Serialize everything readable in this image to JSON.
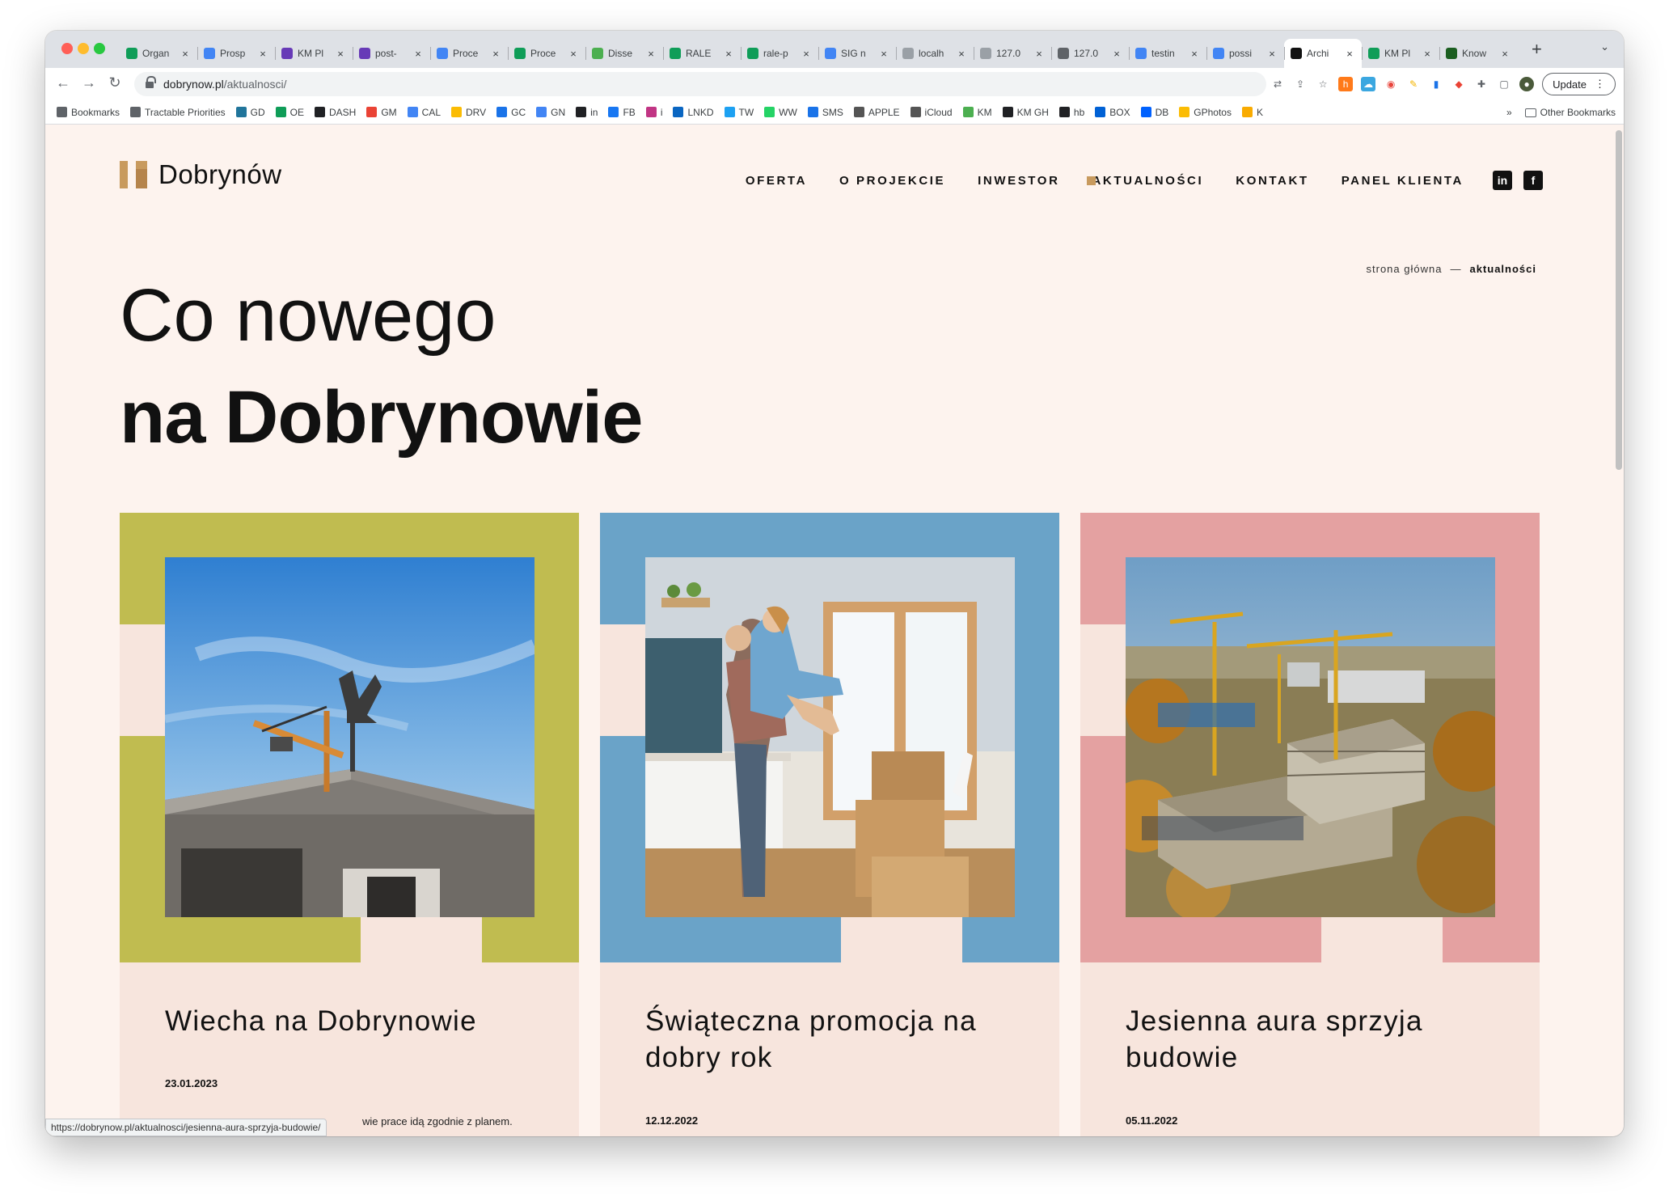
{
  "browser": {
    "tabs": [
      {
        "title": "Organ",
        "icon": "sheets-icon",
        "color": "#0f9d58"
      },
      {
        "title": "Prosp",
        "icon": "drive-icon",
        "color": "#4285f4"
      },
      {
        "title": "KM Pl",
        "icon": "forms-icon",
        "color": "#673ab7"
      },
      {
        "title": "post-",
        "icon": "forms-icon",
        "color": "#673ab7"
      },
      {
        "title": "Proce",
        "icon": "docs-icon",
        "color": "#4285f4"
      },
      {
        "title": "Proce",
        "icon": "sheets-icon",
        "color": "#0f9d58"
      },
      {
        "title": "Disse",
        "icon": "leaf-icon",
        "color": "#4caf50"
      },
      {
        "title": "RALE",
        "icon": "sheets-icon",
        "color": "#0f9d58"
      },
      {
        "title": "rale-p",
        "icon": "sheets-icon",
        "color": "#0f9d58"
      },
      {
        "title": "SIG n",
        "icon": "docs-icon",
        "color": "#4285f4"
      },
      {
        "title": "localh",
        "icon": "page-icon",
        "color": "#9aa0a6"
      },
      {
        "title": "127.0",
        "icon": "page-icon",
        "color": "#9aa0a6"
      },
      {
        "title": "127.0",
        "icon": "globe-icon",
        "color": "#5f6368"
      },
      {
        "title": "testin",
        "icon": "docs-icon",
        "color": "#4285f4"
      },
      {
        "title": "possi",
        "icon": "docs-icon",
        "color": "#4285f4"
      },
      {
        "title": "Archi",
        "icon": "dobrynow-icon",
        "color": "#111111",
        "active": true
      },
      {
        "title": "KM Pl",
        "icon": "sheets-icon",
        "color": "#0f9d58"
      },
      {
        "title": "Know",
        "icon": "kb-icon",
        "color": "#1b5e20"
      }
    ],
    "url_host": "dobrynow.pl",
    "url_path": "/aktualnosci/",
    "update_label": "Update",
    "bookmarks": [
      {
        "label": "Bookmarks",
        "icon": "star-icon",
        "color": "#5f6368"
      },
      {
        "label": "Tractable Priorities",
        "icon": "folder-icon",
        "color": "#5f6368"
      },
      {
        "label": "GD",
        "icon": "wordpress-icon",
        "color": "#21759b"
      },
      {
        "label": "OE",
        "icon": "sheets-icon",
        "color": "#0f9d58"
      },
      {
        "label": "DASH",
        "icon": "bars-icon",
        "color": "#202124"
      },
      {
        "label": "GM",
        "icon": "gmail-icon",
        "color": "#ea4335"
      },
      {
        "label": "CAL",
        "icon": "calendar-icon",
        "color": "#4285f4"
      },
      {
        "label": "DRV",
        "icon": "drive-icon",
        "color": "#fbbc04"
      },
      {
        "label": "GC",
        "icon": "contacts-icon",
        "color": "#1a73e8"
      },
      {
        "label": "GN",
        "icon": "news-icon",
        "color": "#4285f4"
      },
      {
        "label": "in",
        "icon": "text-icon",
        "color": "#202124"
      },
      {
        "label": "FB",
        "icon": "facebook-icon",
        "color": "#1877f2"
      },
      {
        "label": "i",
        "icon": "instagram-icon",
        "color": "#c13584"
      },
      {
        "label": "LNKD",
        "icon": "linkedin-icon",
        "color": "#0a66c2"
      },
      {
        "label": "TW",
        "icon": "twitter-icon",
        "color": "#1da1f2"
      },
      {
        "label": "WW",
        "icon": "whatsapp-icon",
        "color": "#25d366"
      },
      {
        "label": "SMS",
        "icon": "messages-icon",
        "color": "#1a73e8"
      },
      {
        "label": "APPLE",
        "icon": "apple-icon",
        "color": "#555555"
      },
      {
        "label": "iCloud",
        "icon": "apple-icon",
        "color": "#555555"
      },
      {
        "label": "KM",
        "icon": "leaf-icon",
        "color": "#4caf50"
      },
      {
        "label": "KM GH",
        "icon": "github-icon",
        "color": "#202124"
      },
      {
        "label": "hb",
        "icon": "hb-icon",
        "color": "#202124"
      },
      {
        "label": "BOX",
        "icon": "box-icon",
        "color": "#0061d5"
      },
      {
        "label": "DB",
        "icon": "dropbox-icon",
        "color": "#0061fe"
      },
      {
        "label": "GPhotos",
        "icon": "photos-icon",
        "color": "#fbbc04"
      },
      {
        "label": "K",
        "icon": "k-icon",
        "color": "#f9ab00"
      }
    ],
    "bookmarks_overflow": "»",
    "other_bookmarks": "Other Bookmarks",
    "status_url": "https://dobrynow.pl/aktualnosci/jesienna-aura-sprzyja-budowie/"
  },
  "site": {
    "logo_text": "Dobrynów",
    "brand_color": "#c89a5e",
    "nav": [
      "OFERTA",
      "O PROJEKCIE",
      "INWESTOR",
      "AKTUALNOŚCI",
      "KONTAKT",
      "PANEL KLIENTA"
    ],
    "nav_active_index": 3,
    "social": [
      {
        "label": "in",
        "icon": "linkedin-icon"
      },
      {
        "label": "f",
        "icon": "facebook-icon"
      }
    ],
    "breadcrumb": {
      "home": "strona główna",
      "separator": "—",
      "current": "aktualności"
    },
    "hero": {
      "line1": "Co nowego",
      "line2": "na Dobrynowie"
    },
    "articles": [
      {
        "title": "Wiecha na Dobrynowie",
        "date": "23.01.2023",
        "excerpt": "wie prace idą zgodnie z planem.",
        "frame_color": "#c0bc50",
        "image": "crane-on-concrete-building"
      },
      {
        "title": "Świąteczna promocja na dobry rok",
        "date": "12.12.2022",
        "excerpt": "",
        "frame_color": "#6aa3c8",
        "image": "couple-hugging-in-new-kitchen"
      },
      {
        "title": "Jesienna aura sprzyja budowie",
        "date": "05.11.2022",
        "excerpt": "",
        "frame_color": "#e4a1a1",
        "image": "aerial-construction-site"
      }
    ]
  }
}
